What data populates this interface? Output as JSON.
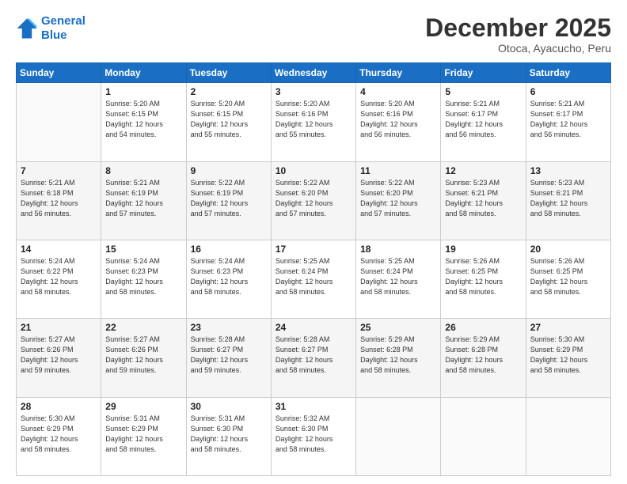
{
  "header": {
    "logo_line1": "General",
    "logo_line2": "Blue",
    "month": "December 2025",
    "location": "Otoca, Ayacucho, Peru"
  },
  "days_of_week": [
    "Sunday",
    "Monday",
    "Tuesday",
    "Wednesday",
    "Thursday",
    "Friday",
    "Saturday"
  ],
  "weeks": [
    [
      {
        "day": "",
        "info": ""
      },
      {
        "day": "1",
        "info": "Sunrise: 5:20 AM\nSunset: 6:15 PM\nDaylight: 12 hours\nand 54 minutes."
      },
      {
        "day": "2",
        "info": "Sunrise: 5:20 AM\nSunset: 6:15 PM\nDaylight: 12 hours\nand 55 minutes."
      },
      {
        "day": "3",
        "info": "Sunrise: 5:20 AM\nSunset: 6:16 PM\nDaylight: 12 hours\nand 55 minutes."
      },
      {
        "day": "4",
        "info": "Sunrise: 5:20 AM\nSunset: 6:16 PM\nDaylight: 12 hours\nand 56 minutes."
      },
      {
        "day": "5",
        "info": "Sunrise: 5:21 AM\nSunset: 6:17 PM\nDaylight: 12 hours\nand 56 minutes."
      },
      {
        "day": "6",
        "info": "Sunrise: 5:21 AM\nSunset: 6:17 PM\nDaylight: 12 hours\nand 56 minutes."
      }
    ],
    [
      {
        "day": "7",
        "info": "Sunrise: 5:21 AM\nSunset: 6:18 PM\nDaylight: 12 hours\nand 56 minutes."
      },
      {
        "day": "8",
        "info": "Sunrise: 5:21 AM\nSunset: 6:19 PM\nDaylight: 12 hours\nand 57 minutes."
      },
      {
        "day": "9",
        "info": "Sunrise: 5:22 AM\nSunset: 6:19 PM\nDaylight: 12 hours\nand 57 minutes."
      },
      {
        "day": "10",
        "info": "Sunrise: 5:22 AM\nSunset: 6:20 PM\nDaylight: 12 hours\nand 57 minutes."
      },
      {
        "day": "11",
        "info": "Sunrise: 5:22 AM\nSunset: 6:20 PM\nDaylight: 12 hours\nand 57 minutes."
      },
      {
        "day": "12",
        "info": "Sunrise: 5:23 AM\nSunset: 6:21 PM\nDaylight: 12 hours\nand 58 minutes."
      },
      {
        "day": "13",
        "info": "Sunrise: 5:23 AM\nSunset: 6:21 PM\nDaylight: 12 hours\nand 58 minutes."
      }
    ],
    [
      {
        "day": "14",
        "info": "Sunrise: 5:24 AM\nSunset: 6:22 PM\nDaylight: 12 hours\nand 58 minutes."
      },
      {
        "day": "15",
        "info": "Sunrise: 5:24 AM\nSunset: 6:23 PM\nDaylight: 12 hours\nand 58 minutes."
      },
      {
        "day": "16",
        "info": "Sunrise: 5:24 AM\nSunset: 6:23 PM\nDaylight: 12 hours\nand 58 minutes."
      },
      {
        "day": "17",
        "info": "Sunrise: 5:25 AM\nSunset: 6:24 PM\nDaylight: 12 hours\nand 58 minutes."
      },
      {
        "day": "18",
        "info": "Sunrise: 5:25 AM\nSunset: 6:24 PM\nDaylight: 12 hours\nand 58 minutes."
      },
      {
        "day": "19",
        "info": "Sunrise: 5:26 AM\nSunset: 6:25 PM\nDaylight: 12 hours\nand 58 minutes."
      },
      {
        "day": "20",
        "info": "Sunrise: 5:26 AM\nSunset: 6:25 PM\nDaylight: 12 hours\nand 58 minutes."
      }
    ],
    [
      {
        "day": "21",
        "info": "Sunrise: 5:27 AM\nSunset: 6:26 PM\nDaylight: 12 hours\nand 59 minutes."
      },
      {
        "day": "22",
        "info": "Sunrise: 5:27 AM\nSunset: 6:26 PM\nDaylight: 12 hours\nand 59 minutes."
      },
      {
        "day": "23",
        "info": "Sunrise: 5:28 AM\nSunset: 6:27 PM\nDaylight: 12 hours\nand 59 minutes."
      },
      {
        "day": "24",
        "info": "Sunrise: 5:28 AM\nSunset: 6:27 PM\nDaylight: 12 hours\nand 58 minutes."
      },
      {
        "day": "25",
        "info": "Sunrise: 5:29 AM\nSunset: 6:28 PM\nDaylight: 12 hours\nand 58 minutes."
      },
      {
        "day": "26",
        "info": "Sunrise: 5:29 AM\nSunset: 6:28 PM\nDaylight: 12 hours\nand 58 minutes."
      },
      {
        "day": "27",
        "info": "Sunrise: 5:30 AM\nSunset: 6:29 PM\nDaylight: 12 hours\nand 58 minutes."
      }
    ],
    [
      {
        "day": "28",
        "info": "Sunrise: 5:30 AM\nSunset: 6:29 PM\nDaylight: 12 hours\nand 58 minutes."
      },
      {
        "day": "29",
        "info": "Sunrise: 5:31 AM\nSunset: 6:29 PM\nDaylight: 12 hours\nand 58 minutes."
      },
      {
        "day": "30",
        "info": "Sunrise: 5:31 AM\nSunset: 6:30 PM\nDaylight: 12 hours\nand 58 minutes."
      },
      {
        "day": "31",
        "info": "Sunrise: 5:32 AM\nSunset: 6:30 PM\nDaylight: 12 hours\nand 58 minutes."
      },
      {
        "day": "",
        "info": ""
      },
      {
        "day": "",
        "info": ""
      },
      {
        "day": "",
        "info": ""
      }
    ]
  ]
}
